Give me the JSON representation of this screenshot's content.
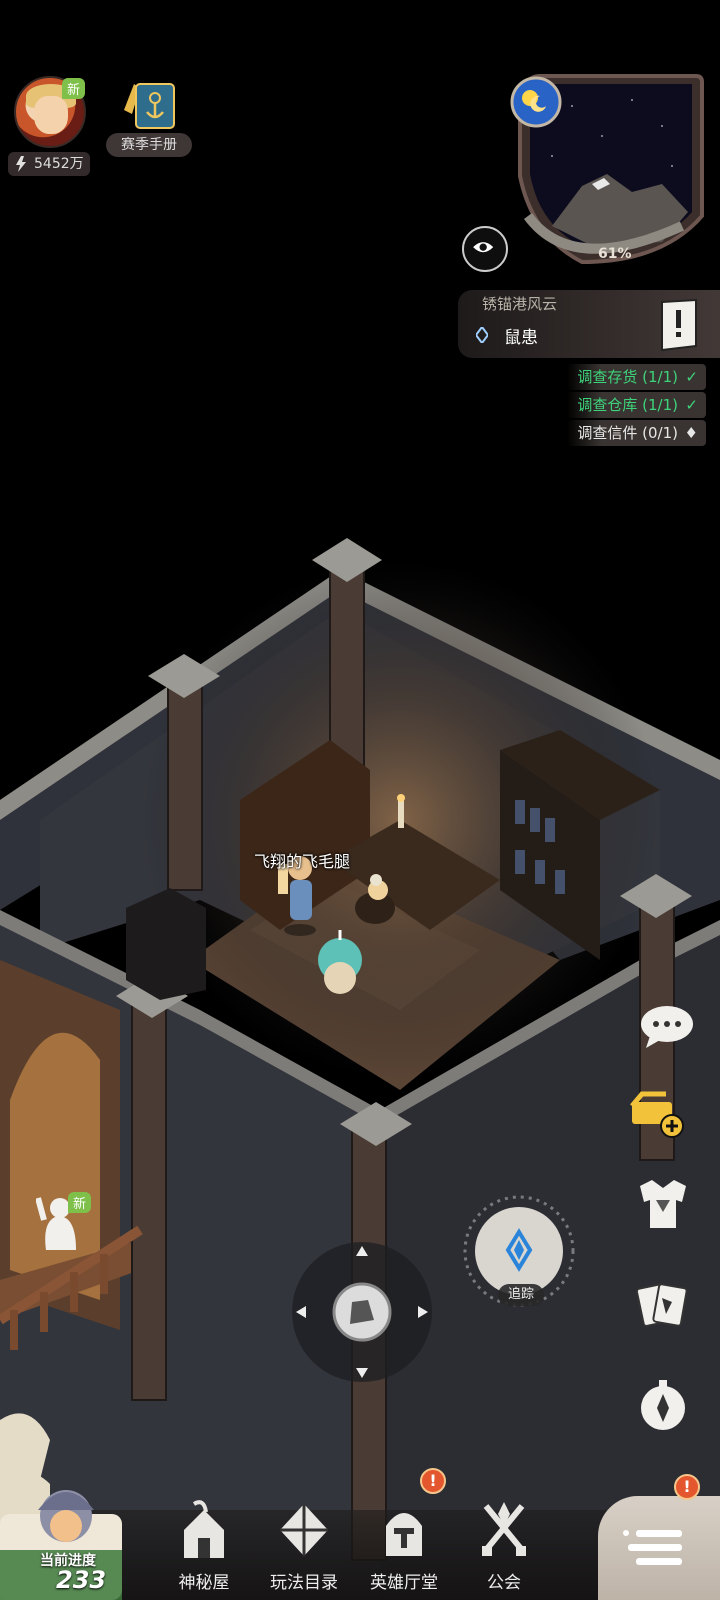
{
  "hud": {
    "new_badge": "新",
    "power_value": "5452万",
    "season_manual_label": "赛季手册"
  },
  "minimap": {
    "day_night": "sun-moon-icon",
    "explore_percent": "61%"
  },
  "quest": {
    "region": "锈锚港风云",
    "title": "鼠患",
    "subtasks": [
      {
        "label": "调查存货 (1/1)",
        "status": "done"
      },
      {
        "label": "调查仓库 (1/1)",
        "status": "done"
      },
      {
        "label": "调查信件 (0/1)",
        "status": "todo"
      }
    ]
  },
  "player": {
    "name": "飞翔的飞毛腿"
  },
  "track": {
    "label": "追踪"
  },
  "npc_new_badge": "新",
  "bottom": {
    "progress_label": "当前进度",
    "progress_value": "233",
    "nav": [
      {
        "label": "神秘屋",
        "icon": "mystery-house-icon",
        "alert": ""
      },
      {
        "label": "玩法目录",
        "icon": "gameplay-catalog-icon",
        "alert": ""
      },
      {
        "label": "英雄厅堂",
        "icon": "hero-hall-icon",
        "alert": "!"
      },
      {
        "label": "公会",
        "icon": "guild-icon",
        "alert": ""
      }
    ],
    "menu_alert": "!"
  },
  "colors": {
    "done": "#3ed27a",
    "alert": "#e4572e",
    "badge_new": "#7ec04a"
  }
}
